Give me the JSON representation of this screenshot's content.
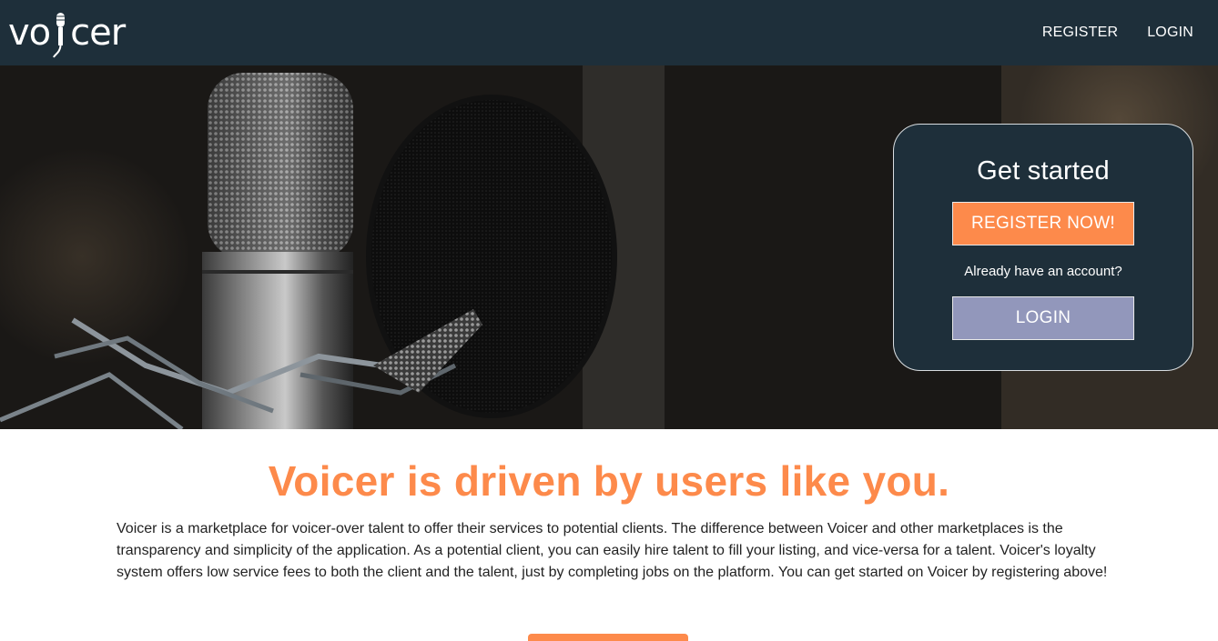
{
  "navbar": {
    "logo_text_left": "vo",
    "logo_text_right": "cer",
    "logo_icon": "microphone-icon",
    "links": [
      "REGISTER",
      "LOGIN"
    ]
  },
  "hero": {
    "image": "studio-microphone-photo"
  },
  "card": {
    "title": "Get started",
    "register_label": "REGISTER NOW!",
    "subtitle": "Already have an account?",
    "login_label": "LOGIN"
  },
  "about": {
    "headline": "Voicer is driven by users like you.",
    "paragraph": "Voicer is a marketplace for voicer-over talent to offer their services to potential clients. The difference between Voicer and other marketplaces is the transparency and simplicity of the application. As a potential client, you can easily hire talent to fill your listing, and vice-versa for a talent. Voicer's loyalty system offers low service fees to both the client and the talent, just by completing jobs on the platform. You can get started on Voicer by registering above!"
  },
  "colors": {
    "navbar": "#1e2f3a",
    "accent": "#fd8a4b",
    "login_button": "#9297bb"
  }
}
